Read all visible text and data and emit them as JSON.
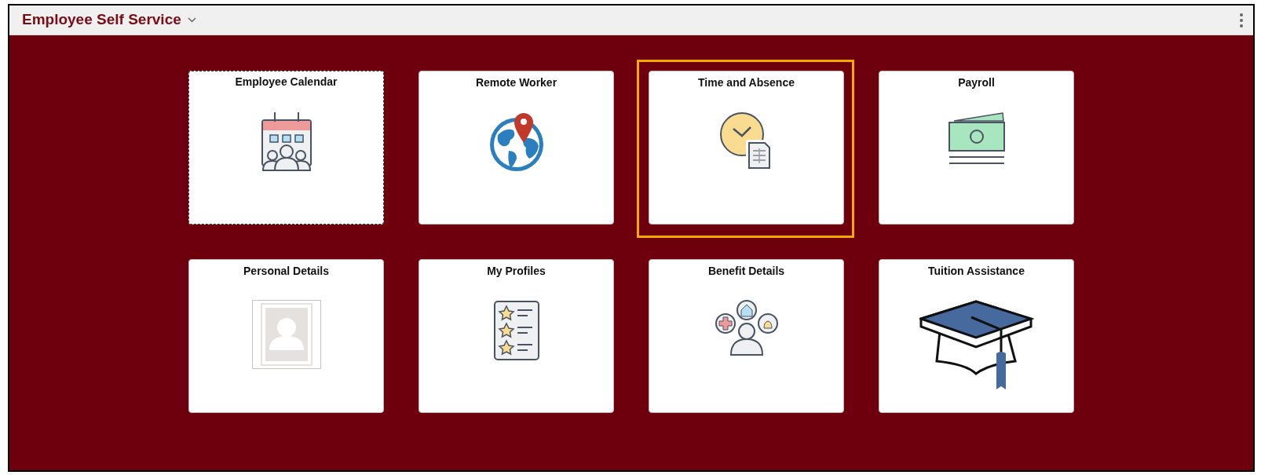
{
  "header": {
    "title": "Employee Self Service"
  },
  "tiles": [
    {
      "label": "Employee Calendar",
      "focused": true,
      "highlighted": false
    },
    {
      "label": "Remote Worker",
      "focused": false,
      "highlighted": false
    },
    {
      "label": "Time and Absence",
      "focused": false,
      "highlighted": true
    },
    {
      "label": "Payroll",
      "focused": false,
      "highlighted": false
    },
    {
      "label": "Personal Details",
      "focused": false,
      "highlighted": false
    },
    {
      "label": "My Profiles",
      "focused": false,
      "highlighted": false
    },
    {
      "label": "Benefit Details",
      "focused": false,
      "highlighted": false
    },
    {
      "label": "Tuition Assistance",
      "focused": false,
      "highlighted": false
    }
  ]
}
